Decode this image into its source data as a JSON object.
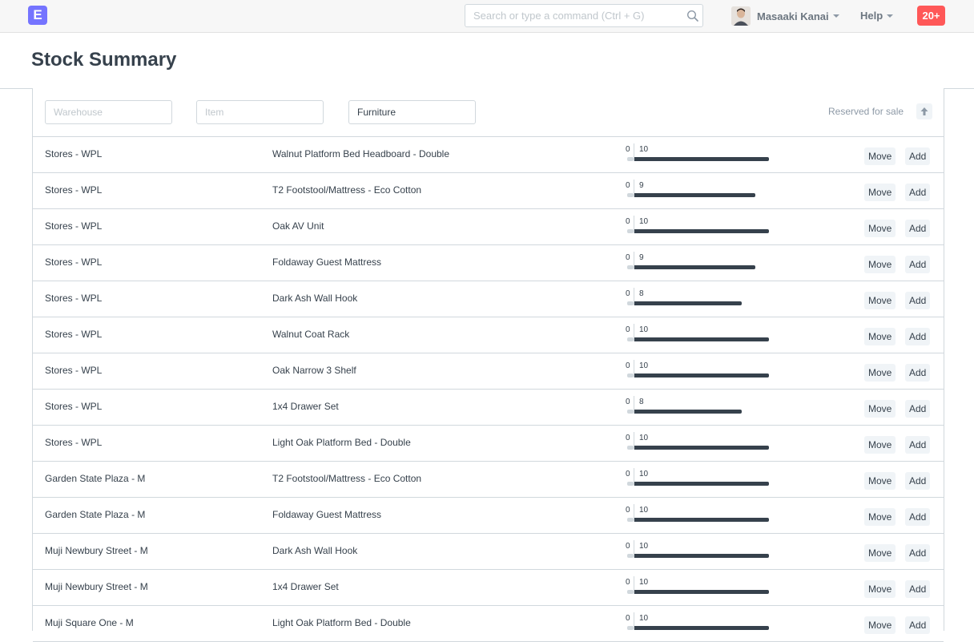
{
  "navbar": {
    "logo_letter": "E",
    "search_placeholder": "Search or type a command (Ctrl + G)",
    "search_icon": "search-icon",
    "user_name": "Masaaki Kanai",
    "help_label": "Help",
    "notifications": "20+",
    "notification_color": "#ff5858",
    "logo_color": "#7574ff"
  },
  "page": {
    "title": "Stock Summary"
  },
  "filters": {
    "warehouse_placeholder": "Warehouse",
    "warehouse_value": "",
    "item_placeholder": "Item",
    "item_value": "",
    "item_group_value": "Furniture",
    "sort_label": "Reserved for sale",
    "sort_icon": "arrow-up-icon"
  },
  "actions": {
    "move_label": "Move",
    "add_label": "Add"
  },
  "rows": [
    {
      "warehouse": "Stores - WPL",
      "item": "Walnut Platform Bed Headboard - Double",
      "reserved": "0",
      "qty": "10",
      "fill": 1.0
    },
    {
      "warehouse": "Stores - WPL",
      "item": "T2 Footstool/Mattress - Eco Cotton",
      "reserved": "0",
      "qty": "9",
      "fill": 0.9
    },
    {
      "warehouse": "Stores - WPL",
      "item": "Oak AV Unit",
      "reserved": "0",
      "qty": "10",
      "fill": 1.0
    },
    {
      "warehouse": "Stores - WPL",
      "item": "Foldaway Guest Mattress",
      "reserved": "0",
      "qty": "9",
      "fill": 0.9
    },
    {
      "warehouse": "Stores - WPL",
      "item": "Dark Ash Wall Hook",
      "reserved": "0",
      "qty": "8",
      "fill": 0.8
    },
    {
      "warehouse": "Stores - WPL",
      "item": "Walnut Coat Rack",
      "reserved": "0",
      "qty": "10",
      "fill": 1.0
    },
    {
      "warehouse": "Stores - WPL",
      "item": "Oak Narrow 3 Shelf",
      "reserved": "0",
      "qty": "10",
      "fill": 1.0
    },
    {
      "warehouse": "Stores - WPL",
      "item": "1x4 Drawer Set",
      "reserved": "0",
      "qty": "8",
      "fill": 0.8
    },
    {
      "warehouse": "Stores - WPL",
      "item": "Light Oak Platform Bed - Double",
      "reserved": "0",
      "qty": "10",
      "fill": 1.0
    },
    {
      "warehouse": "Garden State Plaza - M",
      "item": "T2 Footstool/Mattress - Eco Cotton",
      "reserved": "0",
      "qty": "10",
      "fill": 1.0
    },
    {
      "warehouse": "Garden State Plaza - M",
      "item": "Foldaway Guest Mattress",
      "reserved": "0",
      "qty": "10",
      "fill": 1.0
    },
    {
      "warehouse": "Muji Newbury Street - M",
      "item": "Dark Ash Wall Hook",
      "reserved": "0",
      "qty": "10",
      "fill": 1.0
    },
    {
      "warehouse": "Muji Newbury Street - M",
      "item": "1x4 Drawer Set",
      "reserved": "0",
      "qty": "10",
      "fill": 1.0
    },
    {
      "warehouse": "Muji Square One - M",
      "item": "Light Oak Platform Bed - Double",
      "reserved": "0",
      "qty": "10",
      "fill": 1.0
    }
  ]
}
